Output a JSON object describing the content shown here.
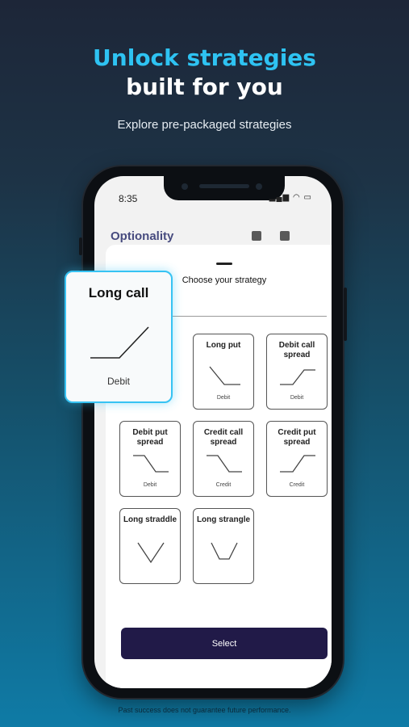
{
  "promo": {
    "headline_line1": "Unlock strategies",
    "headline_line2": "built for you",
    "subtitle": "Explore pre-packaged strategies",
    "disclaimer": "Past success does not guarantee future performance.",
    "accent_color": "#2ec3f2"
  },
  "phone": {
    "status_time": "8:35",
    "status_icons": [
      "signal-icon",
      "wifi-icon",
      "battery-icon"
    ],
    "background_app_logo": "Optionality"
  },
  "sheet": {
    "title": "Choose your strategy",
    "select_label": "Select",
    "select_color": "#211a48"
  },
  "featured": {
    "name": "Long call",
    "type": "Debit",
    "highlight_color": "#37c3f3"
  },
  "strategies": [
    {
      "name": "Long put",
      "type": "Debit",
      "payoff": "long-put"
    },
    {
      "name": "Debit call spread",
      "type": "Debit",
      "payoff": "call-spread"
    },
    {
      "name": "Debit put spread",
      "type": "Debit",
      "payoff": "put-spread"
    },
    {
      "name": "Credit call spread",
      "type": "Credit",
      "payoff": "credit-call-spread"
    },
    {
      "name": "Credit put spread",
      "type": "Credit",
      "payoff": "credit-put-spread"
    },
    {
      "name": "Long straddle",
      "type": "",
      "payoff": "straddle"
    },
    {
      "name": "Long strangle",
      "type": "",
      "payoff": "strangle"
    }
  ]
}
